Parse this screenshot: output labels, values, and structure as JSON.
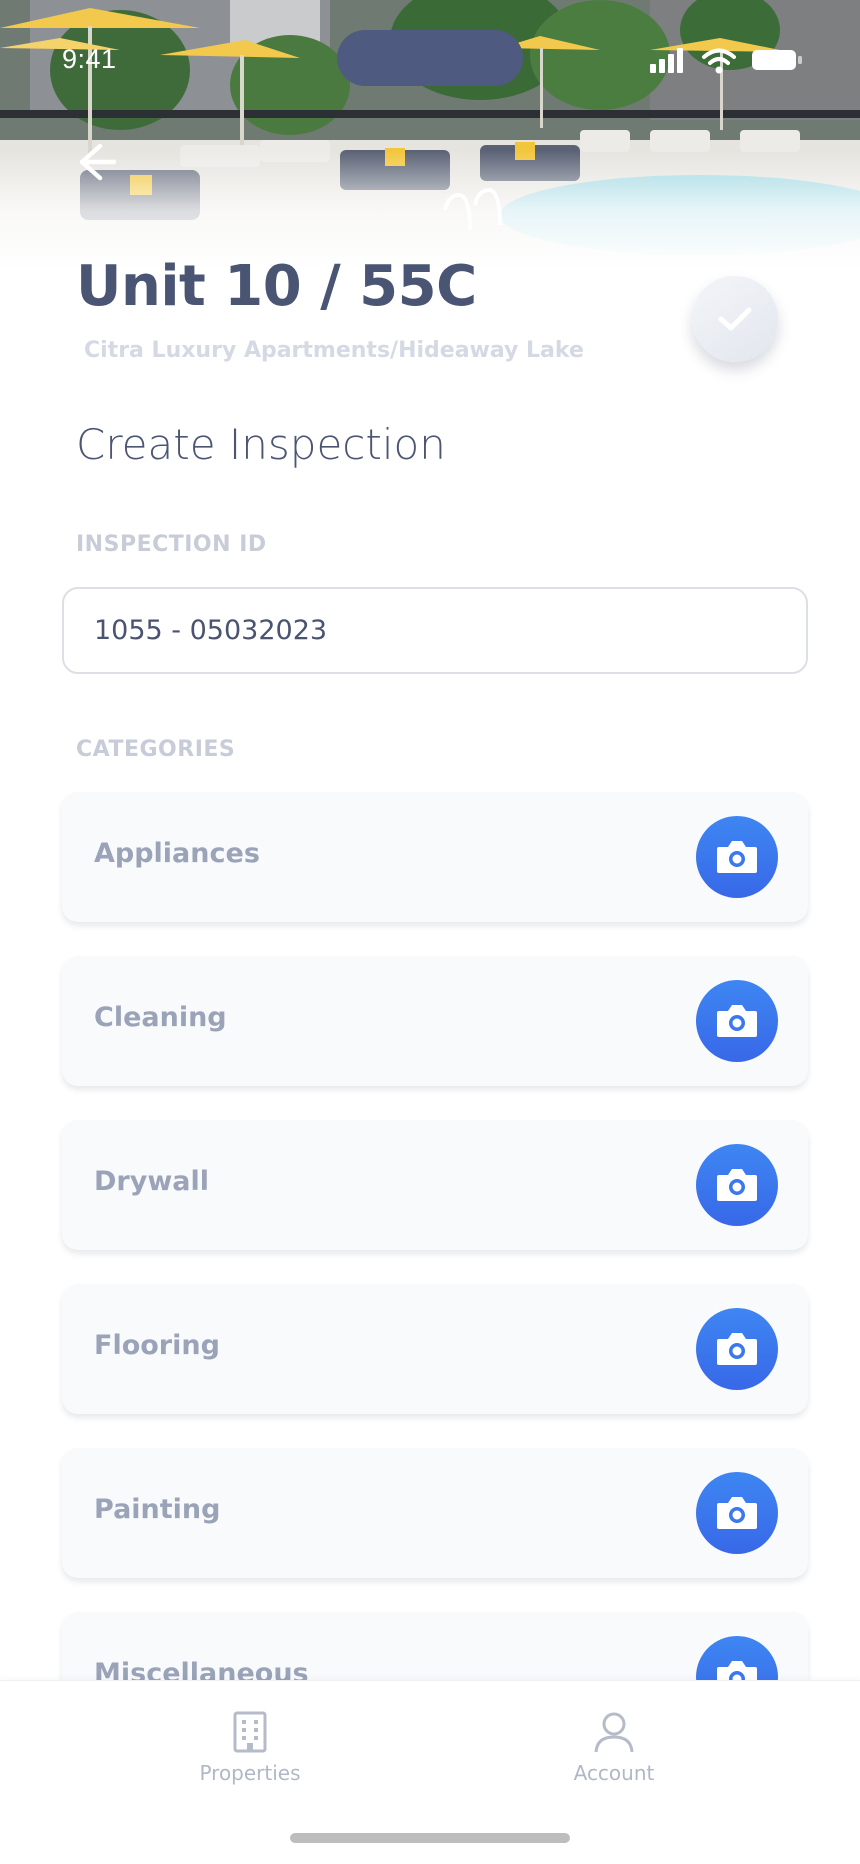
{
  "status_bar": {
    "time": "9:41"
  },
  "header": {
    "unit_title": "Unit 10 / 55C",
    "property_name": "Citra Luxury Apartments/Hideaway Lake"
  },
  "form": {
    "heading": "Create Inspection",
    "inspection_id": {
      "label": "INSPECTION ID",
      "value": "1055 - 05032023"
    },
    "categories_label": "CATEGORIES",
    "categories": [
      {
        "label": "Appliances"
      },
      {
        "label": "Cleaning"
      },
      {
        "label": "Drywall"
      },
      {
        "label": "Flooring"
      },
      {
        "label": "Painting"
      },
      {
        "label": "Miscellaneous"
      }
    ]
  },
  "tabbar": {
    "tabs": [
      {
        "label": "Properties",
        "icon": "building-icon"
      },
      {
        "label": "Account",
        "icon": "person-icon"
      }
    ]
  },
  "colors": {
    "accent_blue": "#3b78ee",
    "title_text": "#4a5573",
    "muted_label": "#c7ccd8",
    "card_bg": "#f9fafc"
  }
}
